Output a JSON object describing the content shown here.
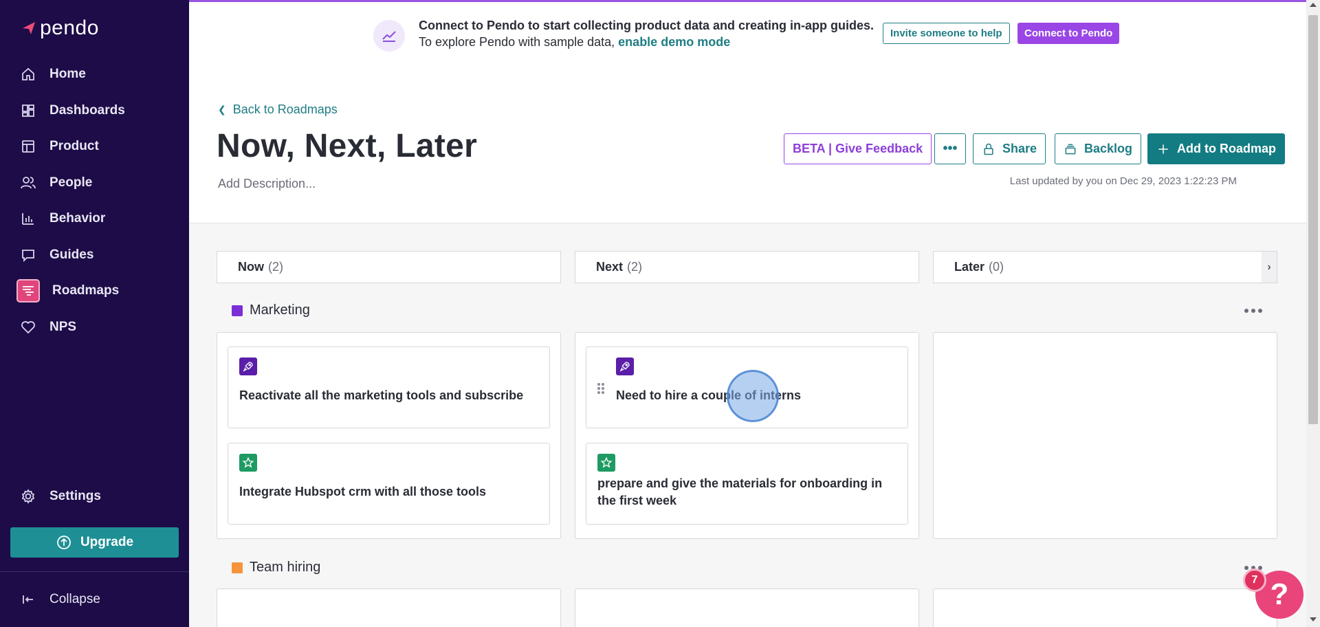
{
  "sidebar": {
    "logo_text": "pendo",
    "items": [
      {
        "label": "Home",
        "icon": "home-icon"
      },
      {
        "label": "Dashboards",
        "icon": "dashboards-icon"
      },
      {
        "label": "Product",
        "icon": "product-icon"
      },
      {
        "label": "People",
        "icon": "people-icon"
      },
      {
        "label": "Behavior",
        "icon": "behavior-icon"
      },
      {
        "label": "Guides",
        "icon": "guides-icon"
      },
      {
        "label": "Roadmaps",
        "icon": "roadmaps-icon",
        "active": true
      },
      {
        "label": "NPS",
        "icon": "heart-icon"
      }
    ],
    "settings_label": "Settings",
    "upgrade_label": "Upgrade",
    "collapse_label": "Collapse"
  },
  "banner": {
    "line1": "Connect to Pendo to start collecting product data and creating in-app guides.",
    "line2_prefix": "To explore Pendo with sample data, ",
    "line2_link": "enable demo mode",
    "invite_label": "Invite someone to help",
    "connect_label": "Connect to Pendo"
  },
  "header": {
    "back_label": "Back to Roadmaps",
    "title": "Now, Next, Later",
    "description_placeholder": "Add Description...",
    "last_updated": "Last updated by you on Dec 29, 2023 1:22:23 PM",
    "beta_label": "BETA | Give Feedback",
    "more_label": "•••",
    "share_label": "Share",
    "backlog_label": "Backlog",
    "add_label": "Add to Roadmap"
  },
  "columns": [
    {
      "name": "Now",
      "count": "(2)"
    },
    {
      "name": "Next",
      "count": "(2)"
    },
    {
      "name": "Later",
      "count": "(0)"
    }
  ],
  "groups": [
    {
      "name": "Marketing",
      "color": "#7c2fd6",
      "now": [
        {
          "text": "Reactivate all the marketing tools and subscribe",
          "icon": "rocket-icon",
          "icon_color": "#5a1ea8"
        },
        {
          "text": "Integrate Hubspot crm with all those tools",
          "icon": "star-icon",
          "icon_color": "#1e9a63"
        }
      ],
      "next": [
        {
          "text": "Need to hire a couple of interns",
          "icon": "rocket-icon",
          "icon_color": "#5a1ea8"
        },
        {
          "text": "prepare and give the materials for onboarding in the first week",
          "icon": "star-icon",
          "icon_color": "#1e9a63"
        }
      ]
    },
    {
      "name": "Team hiring",
      "color": "#f5943a"
    }
  ],
  "help": {
    "badge": "7",
    "glyph": "?"
  },
  "colors": {
    "sidebar_bg": "#1d0c47",
    "accent_teal": "#137b82",
    "accent_purple": "#9a46e6",
    "active_pink": "#e0457b"
  }
}
